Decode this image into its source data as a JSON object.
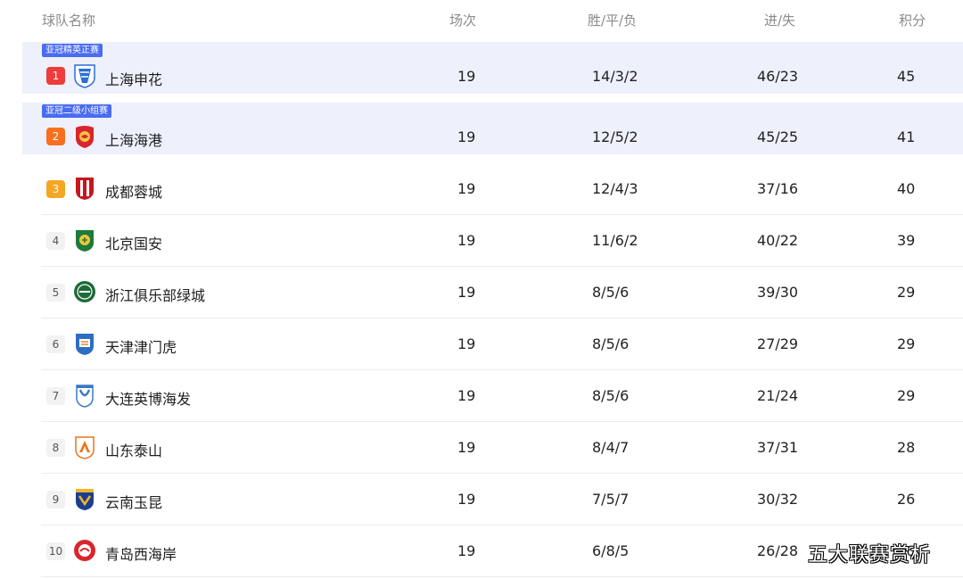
{
  "header": {
    "team": "球队名称",
    "played": "场次",
    "wdl": "胜/平/负",
    "goals": "进/失",
    "points": "积分"
  },
  "rows": [
    {
      "tag": "亚冠精英正赛",
      "rank": "1",
      "name": "上海申花",
      "played": "19",
      "wdl": "14/3/2",
      "goals": "46/23",
      "points": "45",
      "logo": "shenhua-crest-icon"
    },
    {
      "tag": "亚冠二级小组赛",
      "rank": "2",
      "name": "上海海港",
      "played": "19",
      "wdl": "12/5/2",
      "goals": "45/25",
      "points": "41",
      "logo": "haigang-crest-icon"
    },
    {
      "rank": "3",
      "name": "成都蓉城",
      "played": "19",
      "wdl": "12/4/3",
      "goals": "37/16",
      "points": "40",
      "logo": "chengdu-crest-icon"
    },
    {
      "rank": "4",
      "name": "北京国安",
      "played": "19",
      "wdl": "11/6/2",
      "goals": "40/22",
      "points": "39",
      "logo": "guoan-crest-icon"
    },
    {
      "rank": "5",
      "name": "浙江俱乐部绿城",
      "played": "19",
      "wdl": "8/5/6",
      "goals": "39/30",
      "points": "29",
      "logo": "zhejiang-crest-icon"
    },
    {
      "rank": "6",
      "name": "天津津门虎",
      "played": "19",
      "wdl": "8/5/6",
      "goals": "27/29",
      "points": "29",
      "logo": "tianjin-crest-icon"
    },
    {
      "rank": "7",
      "name": "大连英博海发",
      "played": "19",
      "wdl": "8/5/6",
      "goals": "21/24",
      "points": "29",
      "logo": "dalian-crest-icon"
    },
    {
      "rank": "8",
      "name": "山东泰山",
      "played": "19",
      "wdl": "8/4/7",
      "goals": "37/31",
      "points": "28",
      "logo": "taishan-crest-icon"
    },
    {
      "rank": "9",
      "name": "云南玉昆",
      "played": "19",
      "wdl": "7/5/7",
      "goals": "30/32",
      "points": "26",
      "logo": "yunnan-crest-icon"
    },
    {
      "rank": "10",
      "name": "青岛西海岸",
      "played": "19",
      "wdl": "6/8/5",
      "goals": "26/28",
      "points": "26",
      "logo": "qingdao-crest-icon"
    }
  ],
  "watermark": "五大联赛赏析",
  "colors": {
    "highlight_bg": "#eef0fb",
    "tag_bg": "#4a6cf0",
    "rank1": "#ef3b3b",
    "rank2": "#f7701d",
    "rank3": "#f5a623"
  }
}
